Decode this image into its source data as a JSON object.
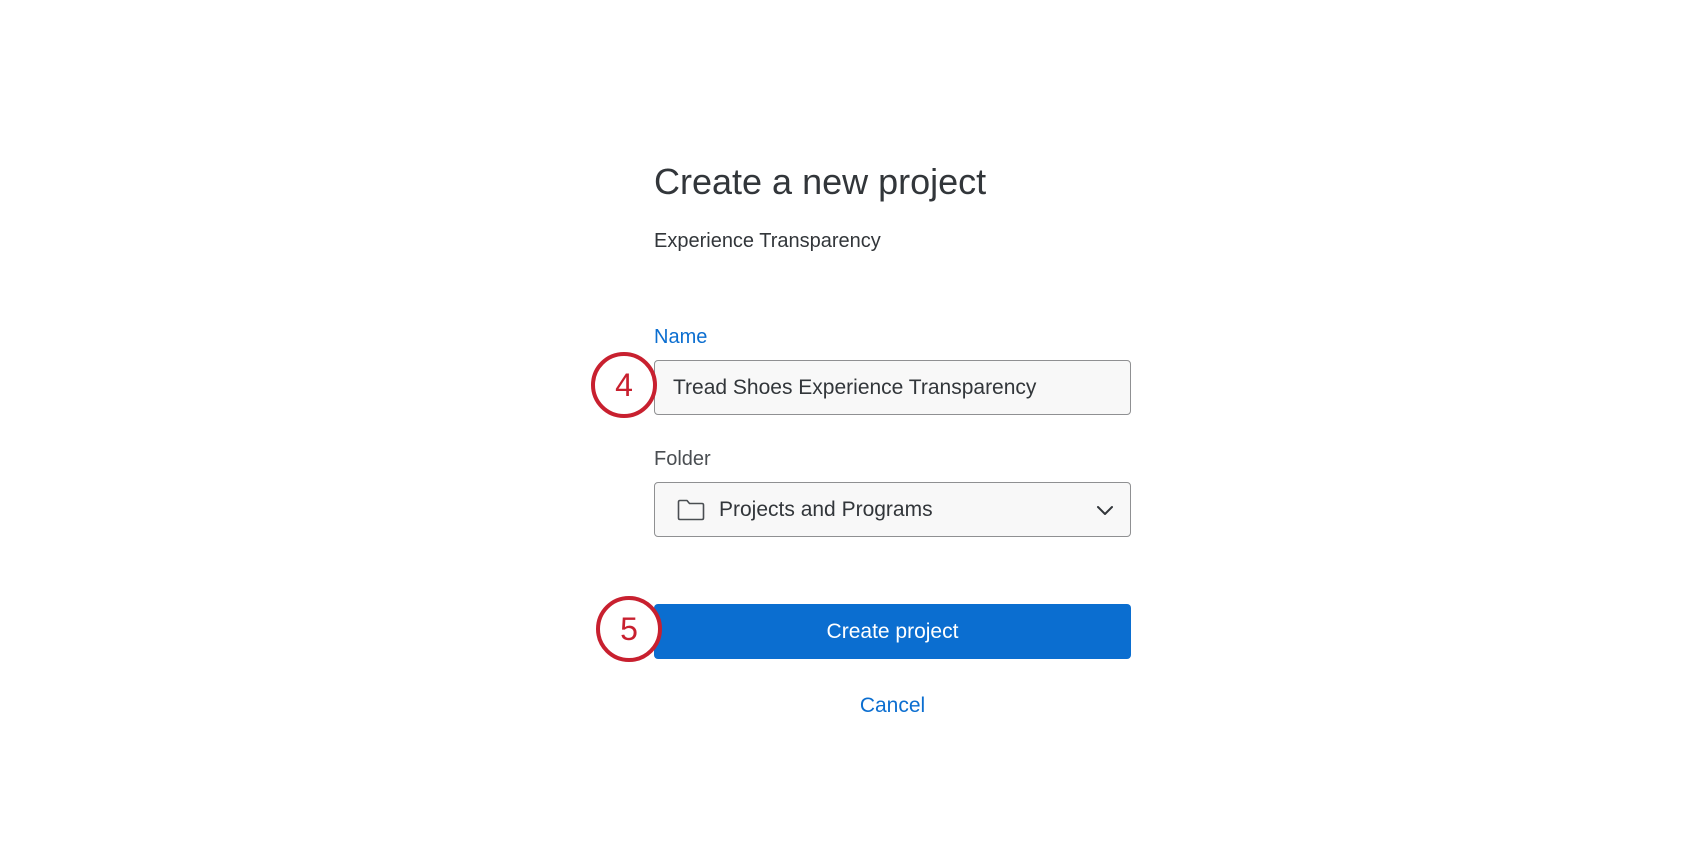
{
  "dialog": {
    "title": "Create a new project",
    "subtitle": "Experience Transparency"
  },
  "form": {
    "name_label": "Name",
    "name_value": "Tread Shoes Experience Transparency",
    "folder_label": "Folder",
    "folder_value": "Projects and Programs",
    "folder_icon": "folder-icon",
    "dropdown_icon": "chevron-down-icon"
  },
  "actions": {
    "create_label": "Create project",
    "cancel_label": "Cancel"
  },
  "annotations": {
    "step_name": "4",
    "step_create": "5",
    "marker_color": "#c8202f"
  },
  "colors": {
    "accent": "#0b6ed0",
    "text": "#32363a"
  }
}
